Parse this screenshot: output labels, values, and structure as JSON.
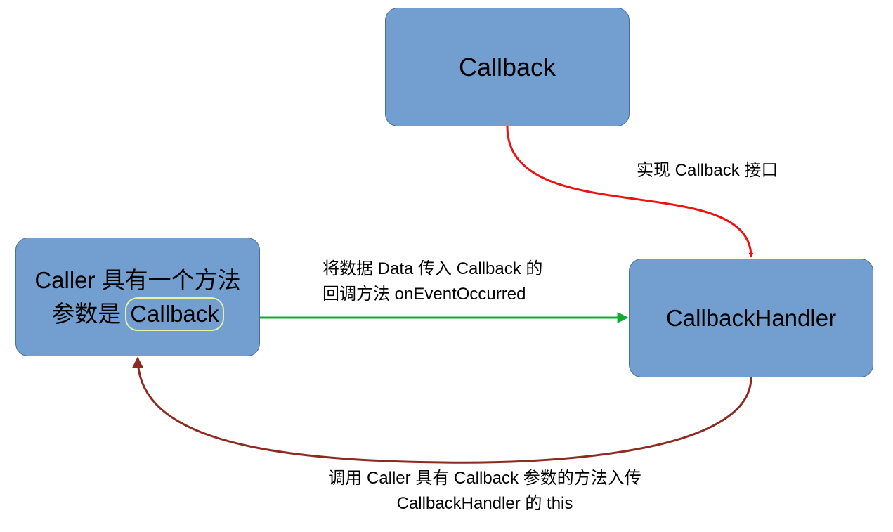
{
  "colors": {
    "box_fill": "#729fcf",
    "box_border": "#4a6e9c",
    "implement_arrow": "#ee1111",
    "pass_arrow": "#11aa33",
    "invoke_arrow": "#8b2b22",
    "param_highlight": "#e8f0a8"
  },
  "nodes": {
    "callback": {
      "label": "Callback"
    },
    "handler": {
      "label": "CallbackHandler"
    },
    "caller": {
      "line1": "Caller 具有一个方法",
      "line2_prefix": "参数是",
      "param": "Callback"
    }
  },
  "edges": {
    "implement": {
      "label": "实现 Callback 接口"
    },
    "pass": {
      "line1": "将数据 Data 传入 Callback 的",
      "line2": "回调方法 onEventOccurred"
    },
    "invoke": {
      "line1": "调用 Caller 具有 Callback 参数的方法入传",
      "line2": "CallbackHandler 的 this"
    }
  }
}
